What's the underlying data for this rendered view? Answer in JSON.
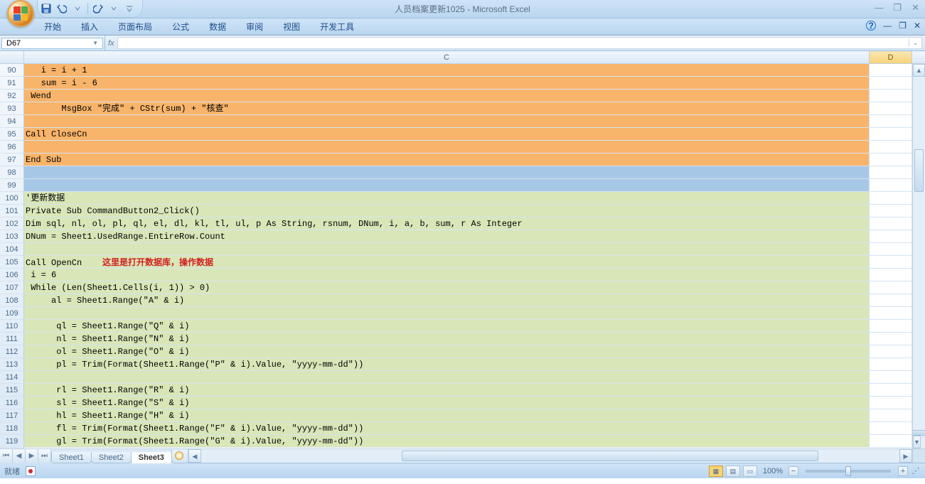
{
  "app": {
    "title": "人员档案更新1025 - Microsoft Excel"
  },
  "ribbon": {
    "tabs": [
      "开始",
      "插入",
      "页面布局",
      "公式",
      "数据",
      "审阅",
      "视图",
      "开发工具"
    ]
  },
  "namebox": {
    "value": "D67"
  },
  "columns": {
    "c": "C",
    "d": "D"
  },
  "rows": [
    {
      "n": "90",
      "bg": "orange",
      "text": "   i = i + 1"
    },
    {
      "n": "91",
      "bg": "orange",
      "text": "   sum = i - 6"
    },
    {
      "n": "92",
      "bg": "orange",
      "text": " Wend"
    },
    {
      "n": "93",
      "bg": "orange",
      "text": "       MsgBox \"完成\" + CStr(sum) + \"核查\""
    },
    {
      "n": "94",
      "bg": "orange",
      "text": ""
    },
    {
      "n": "95",
      "bg": "orange",
      "text": "Call CloseCn"
    },
    {
      "n": "96",
      "bg": "orange",
      "text": ""
    },
    {
      "n": "97",
      "bg": "orange",
      "text": "End Sub"
    },
    {
      "n": "98",
      "bg": "blue",
      "text": ""
    },
    {
      "n": "99",
      "bg": "blue",
      "text": ""
    },
    {
      "n": "100",
      "bg": "green",
      "text": "'更新数据"
    },
    {
      "n": "101",
      "bg": "green",
      "text": "Private Sub CommandButton2_Click()"
    },
    {
      "n": "102",
      "bg": "green",
      "text": "Dim sql, nl, ol, pl, ql, el, dl, kl, tl, ul, p As String, rsnum, DNum, i, a, b, sum, r As Integer"
    },
    {
      "n": "103",
      "bg": "green",
      "text": "DNum = Sheet1.UsedRange.EntireRow.Count"
    },
    {
      "n": "104",
      "bg": "green",
      "text": ""
    },
    {
      "n": "105",
      "bg": "green",
      "text": "Call OpenCn    ",
      "red": "这里是打开数据库，操作数据"
    },
    {
      "n": "106",
      "bg": "green",
      "text": " i = 6"
    },
    {
      "n": "107",
      "bg": "green",
      "text": " While (Len(Sheet1.Cells(i, 1)) > 0)"
    },
    {
      "n": "108",
      "bg": "green",
      "text": "     al = Sheet1.Range(\"A\" & i)"
    },
    {
      "n": "109",
      "bg": "green",
      "text": ""
    },
    {
      "n": "110",
      "bg": "green",
      "text": "      ql = Sheet1.Range(\"Q\" & i)"
    },
    {
      "n": "111",
      "bg": "green",
      "text": "      nl = Sheet1.Range(\"N\" & i)"
    },
    {
      "n": "112",
      "bg": "green",
      "text": "      ol = Sheet1.Range(\"O\" & i)"
    },
    {
      "n": "113",
      "bg": "green",
      "text": "      pl = Trim(Format(Sheet1.Range(\"P\" & i).Value, \"yyyy-mm-dd\"))"
    },
    {
      "n": "114",
      "bg": "green",
      "text": ""
    },
    {
      "n": "115",
      "bg": "green",
      "text": "      rl = Sheet1.Range(\"R\" & i)"
    },
    {
      "n": "116",
      "bg": "green",
      "text": "      sl = Sheet1.Range(\"S\" & i)"
    },
    {
      "n": "117",
      "bg": "green",
      "text": "      hl = Sheet1.Range(\"H\" & i)"
    },
    {
      "n": "118",
      "bg": "green",
      "text": "      fl = Trim(Format(Sheet1.Range(\"F\" & i).Value, \"yyyy-mm-dd\"))"
    },
    {
      "n": "119",
      "bg": "green",
      "text": "      gl = Trim(Format(Sheet1.Range(\"G\" & i).Value, \"yyyy-mm-dd\"))"
    }
  ],
  "sheets": {
    "tabs": [
      "Sheet1",
      "Sheet2",
      "Sheet3"
    ],
    "active": "Sheet3"
  },
  "status": {
    "ready": "就绪",
    "zoom": "100%"
  }
}
